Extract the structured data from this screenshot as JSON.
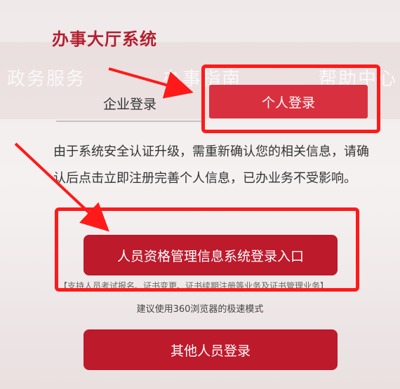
{
  "header": {
    "title": "办事大厅系统"
  },
  "background": {
    "faint_nav": [
      "政务服务",
      "办事指南",
      "帮助中心"
    ]
  },
  "tabs": {
    "enterprise_label": "企业登录",
    "personal_label": "个人登录"
  },
  "notice": {
    "text": "由于系统安全认证升级，需重新确认您的相关信息，请确认后点击立即注册完善个人信息，已办业务不受影响。"
  },
  "buttons": {
    "main_login": "人员资格管理信息系统登录入口",
    "other_login": "其他人员登录"
  },
  "subnote": {
    "text": "【支持人员考试报名、证书变更、证书续期注册等业务及证书管理业务】"
  },
  "browser_tip": {
    "text": "建议使用360浏览器的极速模式"
  },
  "colors": {
    "brand_red": "#b3202f",
    "tab_active": "#d9303f",
    "button_red": "#bd1a2c",
    "highlight_red": "#ff1a1a"
  }
}
